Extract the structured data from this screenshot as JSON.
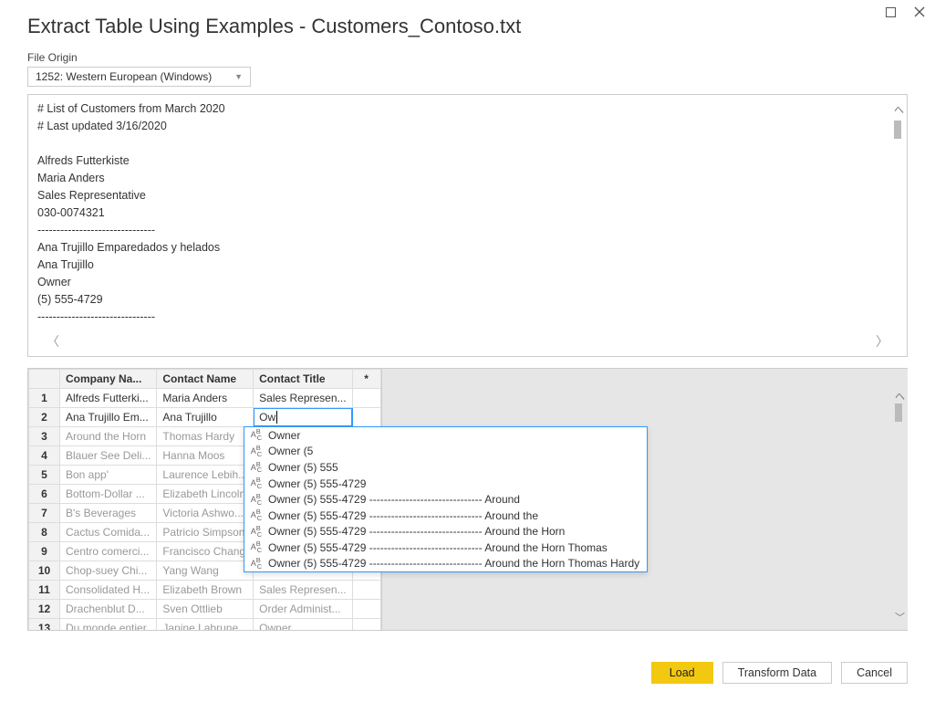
{
  "title": "Extract Table Using Examples - Customers_Contoso.txt",
  "fileOrigin": {
    "label": "File Origin",
    "value": "1252: Western European (Windows)"
  },
  "previewLines": [
    "# List of Customers from March 2020",
    "# Last updated 3/16/2020",
    "",
    "Alfreds Futterkiste",
    "Maria Anders",
    "Sales Representative",
    "030-0074321",
    "-------------------------------",
    "Ana Trujillo Emparedados y helados",
    "Ana Trujillo",
    "Owner",
    "(5) 555-4729",
    "-------------------------------"
  ],
  "grid": {
    "columns": [
      "Company Na...",
      "Contact Name",
      "Contact Title",
      "*"
    ],
    "activeCell": "Ow",
    "rows": [
      {
        "n": "1",
        "company": "Alfreds Futterki...",
        "contact": "Maria Anders",
        "title": "Sales Represen...",
        "suggested": false
      },
      {
        "n": "2",
        "company": "Ana Trujillo Em...",
        "contact": "Ana Trujillo",
        "title": "",
        "suggested": false,
        "editing": true
      },
      {
        "n": "3",
        "company": "Around the Horn",
        "contact": "Thomas Hardy",
        "title": "",
        "suggested": true
      },
      {
        "n": "4",
        "company": "Blauer See Deli...",
        "contact": "Hanna Moos",
        "title": "",
        "suggested": true
      },
      {
        "n": "5",
        "company": "Bon app'",
        "contact": "Laurence Lebih...",
        "title": "",
        "suggested": true
      },
      {
        "n": "6",
        "company": "Bottom-Dollar ...",
        "contact": "Elizabeth Lincoln",
        "title": "",
        "suggested": true
      },
      {
        "n": "7",
        "company": "B's Beverages",
        "contact": "Victoria Ashwo...",
        "title": "",
        "suggested": true
      },
      {
        "n": "8",
        "company": "Cactus Comida...",
        "contact": "Patricio Simpson",
        "title": "",
        "suggested": true
      },
      {
        "n": "9",
        "company": "Centro comerci...",
        "contact": "Francisco Chang",
        "title": "",
        "suggested": true
      },
      {
        "n": "10",
        "company": "Chop-suey Chi...",
        "contact": "Yang Wang",
        "title": "",
        "suggested": true
      },
      {
        "n": "11",
        "company": "Consolidated H...",
        "contact": "Elizabeth Brown",
        "title": "Sales Represen...",
        "suggested": true
      },
      {
        "n": "12",
        "company": "Drachenblut D...",
        "contact": "Sven Ottlieb",
        "title": "Order Administ...",
        "suggested": true
      },
      {
        "n": "13",
        "company": "Du monde entier",
        "contact": "Janine Labrune",
        "title": "Owner",
        "suggested": true
      }
    ]
  },
  "suggestions": [
    "Owner",
    "Owner (5",
    "Owner (5) 555",
    "Owner (5) 555-4729",
    "Owner (5) 555-4729 ------------------------------- Around",
    "Owner (5) 555-4729 ------------------------------- Around the",
    "Owner (5) 555-4729 ------------------------------- Around the Horn",
    "Owner (5) 555-4729 ------------------------------- Around the Horn Thomas",
    "Owner (5) 555-4729 ------------------------------- Around the Horn Thomas Hardy"
  ],
  "buttons": {
    "load": "Load",
    "transform": "Transform Data",
    "cancel": "Cancel"
  }
}
